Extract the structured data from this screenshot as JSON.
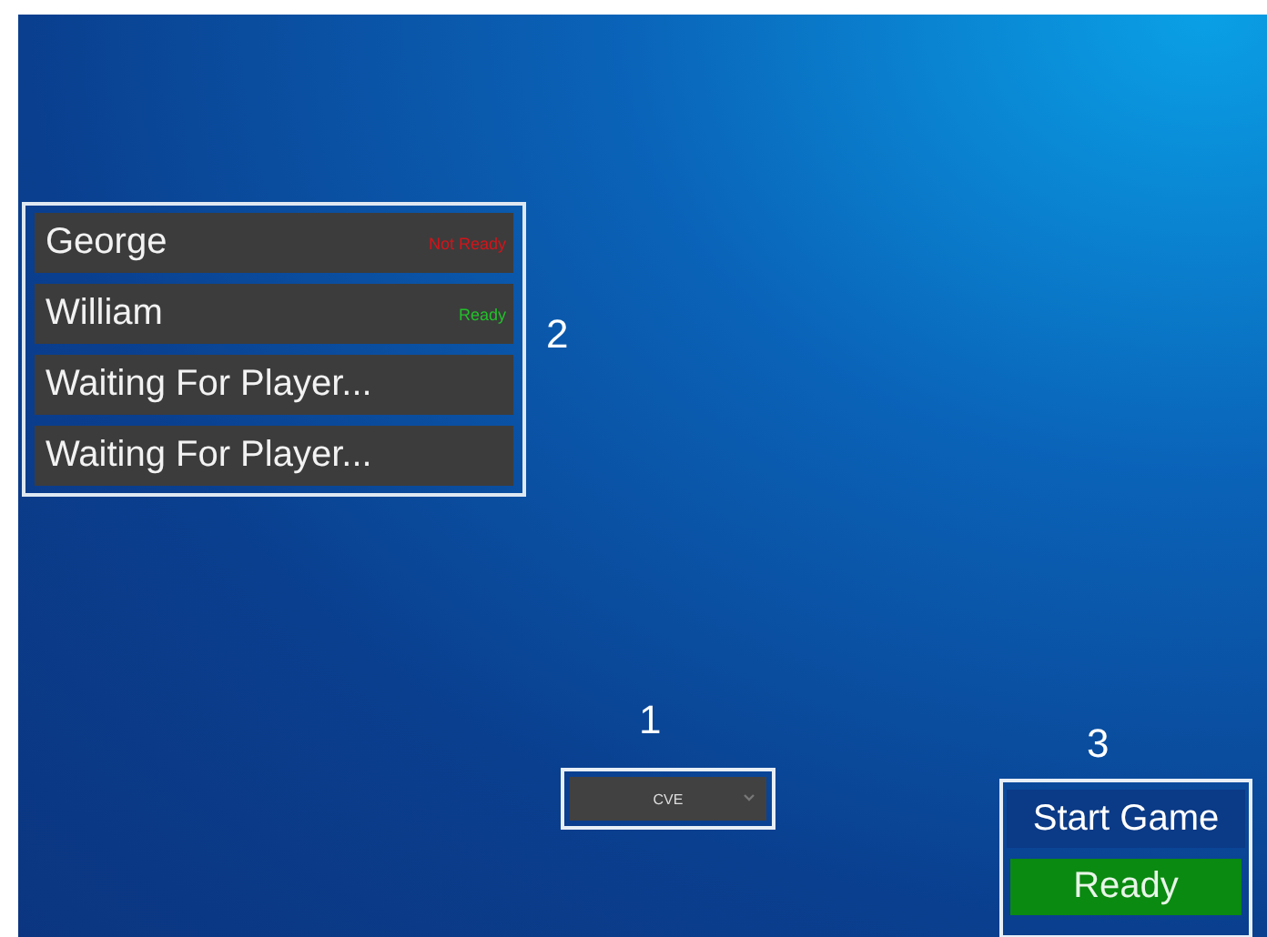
{
  "player_list": {
    "marker": "2",
    "players": [
      {
        "name": "George",
        "status": "Not Ready",
        "ready": false
      },
      {
        "name": "William",
        "status": "Ready",
        "ready": true
      },
      {
        "name": "Waiting For Player..."
      },
      {
        "name": "Waiting For Player..."
      }
    ]
  },
  "mode_select": {
    "marker": "1",
    "value": "CVE"
  },
  "game_controls": {
    "marker": "3",
    "start_label": "Start Game",
    "ready_label": "Ready"
  }
}
